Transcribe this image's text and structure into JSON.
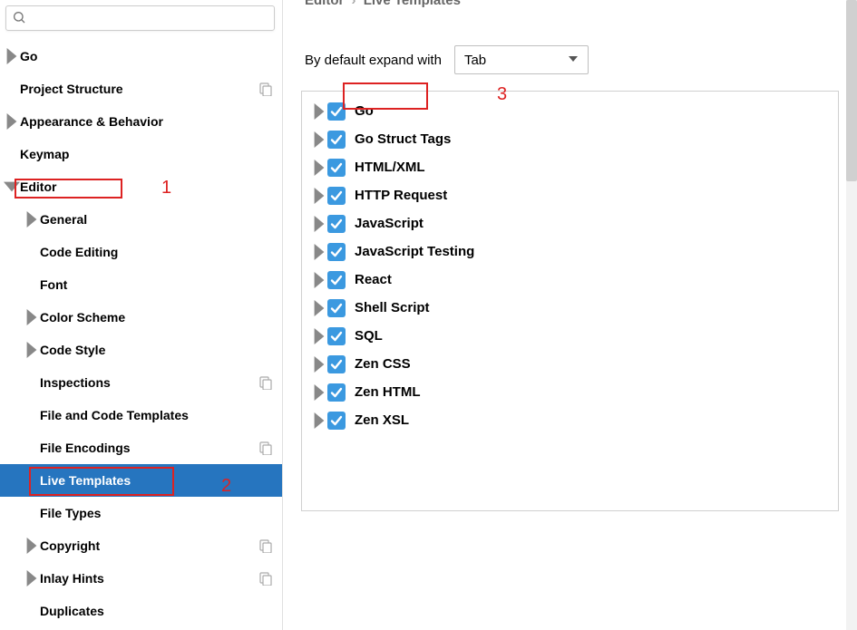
{
  "search": {
    "placeholder": ""
  },
  "sidebar": {
    "items": [
      {
        "label": "Go",
        "indent": 0,
        "chev": "right"
      },
      {
        "label": "Project Structure",
        "indent": 0,
        "chev": "",
        "mark": true
      },
      {
        "label": "Appearance & Behavior",
        "indent": 0,
        "chev": "right"
      },
      {
        "label": "Keymap",
        "indent": 0,
        "chev": ""
      },
      {
        "label": "Editor",
        "indent": 0,
        "chev": "down"
      },
      {
        "label": "General",
        "indent": 1,
        "chev": "right"
      },
      {
        "label": "Code Editing",
        "indent": 1,
        "chev": ""
      },
      {
        "label": "Font",
        "indent": 1,
        "chev": ""
      },
      {
        "label": "Color Scheme",
        "indent": 1,
        "chev": "right"
      },
      {
        "label": "Code Style",
        "indent": 1,
        "chev": "right"
      },
      {
        "label": "Inspections",
        "indent": 1,
        "chev": "",
        "mark": true
      },
      {
        "label": "File and Code Templates",
        "indent": 1,
        "chev": ""
      },
      {
        "label": "File Encodings",
        "indent": 1,
        "chev": "",
        "mark": true
      },
      {
        "label": "Live Templates",
        "indent": 1,
        "chev": "",
        "selected": true
      },
      {
        "label": "File Types",
        "indent": 1,
        "chev": ""
      },
      {
        "label": "Copyright",
        "indent": 1,
        "chev": "right",
        "mark": true
      },
      {
        "label": "Inlay Hints",
        "indent": 1,
        "chev": "right",
        "mark": true
      },
      {
        "label": "Duplicates",
        "indent": 1,
        "chev": ""
      }
    ]
  },
  "breadcrumb": {
    "a": "Editor",
    "b": "Live Templates"
  },
  "expand": {
    "label": "By default expand with",
    "value": "Tab"
  },
  "templates": [
    {
      "label": "Go",
      "checked": true
    },
    {
      "label": "Go Struct Tags",
      "checked": true
    },
    {
      "label": "HTML/XML",
      "checked": true
    },
    {
      "label": "HTTP Request",
      "checked": true
    },
    {
      "label": "JavaScript",
      "checked": true
    },
    {
      "label": "JavaScript Testing",
      "checked": true
    },
    {
      "label": "React",
      "checked": true
    },
    {
      "label": "Shell Script",
      "checked": true
    },
    {
      "label": "SQL",
      "checked": true
    },
    {
      "label": "Zen CSS",
      "checked": true
    },
    {
      "label": "Zen HTML",
      "checked": true
    },
    {
      "label": "Zen XSL",
      "checked": true
    }
  ],
  "annotations": {
    "n1": "1",
    "n2": "2",
    "n3": "3"
  }
}
